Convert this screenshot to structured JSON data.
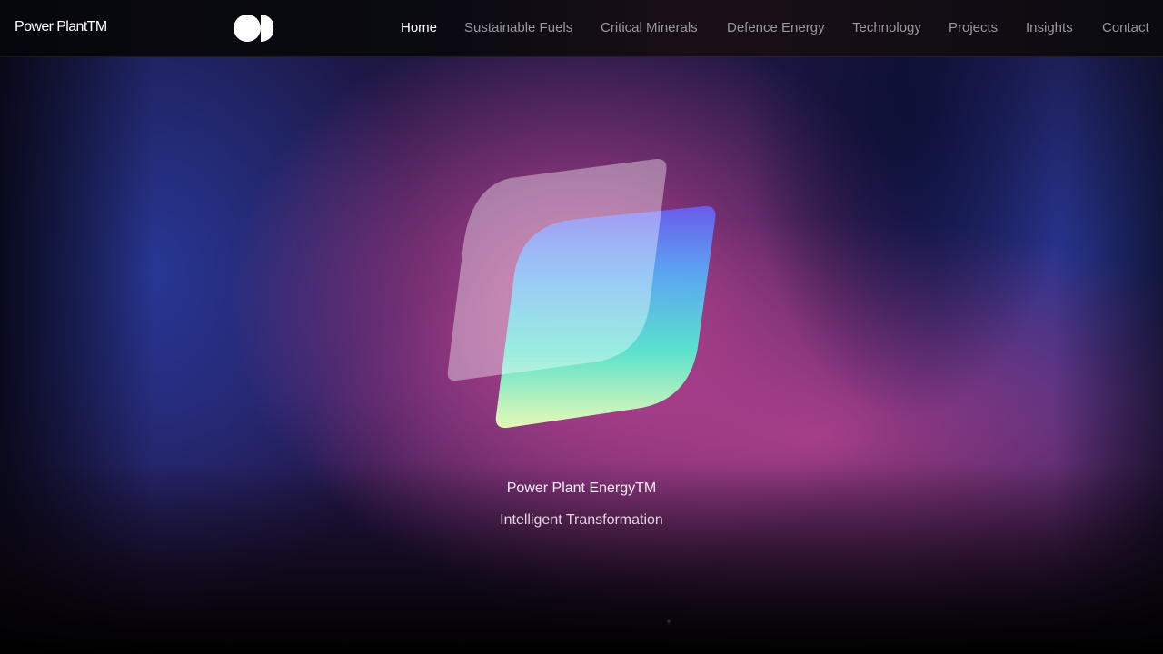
{
  "header": {
    "brand": "Power PlantTM",
    "logo_icon": "twin-circle-logo-icon",
    "nav": [
      {
        "label": "Home",
        "active": true
      },
      {
        "label": "Sustainable Fuels",
        "active": false
      },
      {
        "label": "Critical Minerals",
        "active": false
      },
      {
        "label": "Defence Energy",
        "active": false
      },
      {
        "label": "Technology",
        "active": false
      },
      {
        "label": "Projects",
        "active": false
      },
      {
        "label": "Insights",
        "active": false
      },
      {
        "label": "Contact",
        "active": false
      }
    ]
  },
  "hero": {
    "emblem_icon": "layered-leaf-emblem-icon",
    "title": "Power Plant EnergyTM",
    "subtitle": "Intelligent Transformation"
  },
  "colors": {
    "nav_active": "#ffffff",
    "nav_inactive": "#9a97a0",
    "accent_pink": "#c8469a",
    "accent_blue": "#283ca0",
    "emblem_gradient": [
      "#6a5cf0",
      "#5aa8f5",
      "#58e6d0",
      "#e8ffb8"
    ]
  }
}
